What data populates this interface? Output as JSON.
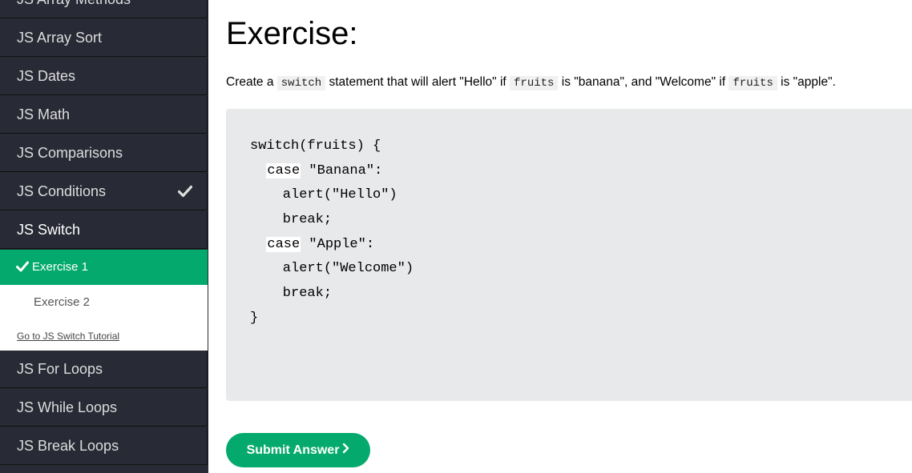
{
  "sidebar": {
    "items_top": [
      {
        "label": "JS Array Methods"
      },
      {
        "label": "JS Array Sort"
      },
      {
        "label": "JS Dates"
      },
      {
        "label": "JS Math"
      },
      {
        "label": "JS Comparisons"
      },
      {
        "label": "JS Conditions",
        "completed": true
      },
      {
        "label": "JS Switch",
        "active": true
      }
    ],
    "sub": {
      "exercises": [
        {
          "label": "Exercise 1",
          "completed": true
        },
        {
          "label": "Exercise 2",
          "completed": false
        }
      ],
      "tutorial_link": "Go to JS Switch Tutorial"
    },
    "items_bottom": [
      {
        "label": "JS For Loops"
      },
      {
        "label": "JS While Loops"
      },
      {
        "label": "JS Break Loops"
      }
    ]
  },
  "main": {
    "title": "Exercise:",
    "desc": {
      "p1": "Create a ",
      "k1": "switch",
      "p2": " statement that will alert \"Hello\" if ",
      "k2": "fruits",
      "p3": " is \"banana\", and \"Welcome\" if ",
      "k3": "fruits",
      "p4": " is \"apple\"."
    },
    "code": {
      "line1": "switch(fruits) {",
      "blank1": "case",
      "line2_rest": " \"Banana\":",
      "line3": "    alert(\"Hello\")",
      "line4": "    break;",
      "blank2": "case",
      "line5_rest": " \"Apple\":",
      "line6": "    alert(\"Welcome\")",
      "line7": "    break;",
      "line8": "}"
    },
    "submit_label": "Submit Answer",
    "submit_icon": "chevron-right-icon"
  },
  "colors": {
    "sidebar_bg": "#282A35",
    "accent_green": "#04AA6D",
    "code_bg": "#E7E9EB"
  }
}
